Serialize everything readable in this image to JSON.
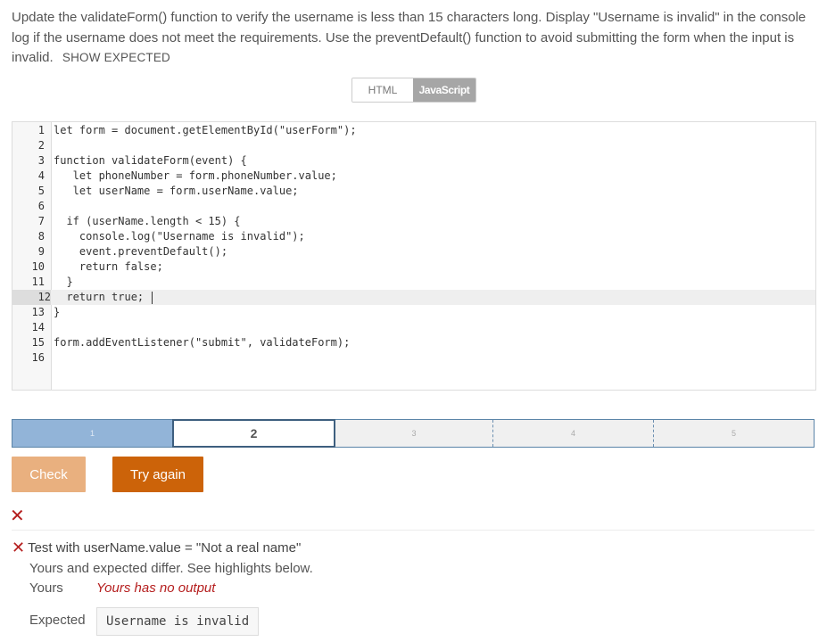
{
  "instructions": {
    "text": "Update the validateForm() function to verify the username is less than 15 characters long. Display \"Username is invalid\" in the console log if the username does not meet the requirements. Use the preventDefault() function to avoid submitting the form when the input is invalid.",
    "show_expected_label": "SHOW EXPECTED"
  },
  "lang_tabs": {
    "html": "HTML",
    "javascript": "JavaScript",
    "selected": "JavaScript"
  },
  "editor": {
    "active_line": 12,
    "lines": [
      {
        "n": "1",
        "text": "let form = document.getElementById(\"userForm\");"
      },
      {
        "n": "2",
        "text": ""
      },
      {
        "n": "3",
        "text": "function validateForm(event) {"
      },
      {
        "n": "4",
        "text": "   let phoneNumber = form.phoneNumber.value;"
      },
      {
        "n": "5",
        "text": "   let userName = form.userName.value;"
      },
      {
        "n": "6",
        "text": ""
      },
      {
        "n": "7",
        "text": "  if (userName.length < 15) {"
      },
      {
        "n": "8",
        "text": "    console.log(\"Username is invalid\");"
      },
      {
        "n": "9",
        "text": "    event.preventDefault();"
      },
      {
        "n": "10",
        "text": "    return false;"
      },
      {
        "n": "11",
        "text": "  }"
      },
      {
        "n": "12",
        "text": "  return true; "
      },
      {
        "n": "13",
        "text": "}"
      },
      {
        "n": "14",
        "text": ""
      },
      {
        "n": "15",
        "text": "form.addEventListener(\"submit\", validateForm);"
      },
      {
        "n": "16",
        "text": ""
      }
    ]
  },
  "progress": {
    "steps": [
      "1",
      "2",
      "3",
      "4",
      "5"
    ],
    "current": 2,
    "completed": [
      1
    ]
  },
  "buttons": {
    "check": "Check",
    "try_again": "Try again"
  },
  "results": {
    "x_symbol": "✕",
    "test_label": "Test with userName.value = \"Not a real name\"",
    "differ_text": "Yours and expected differ. See highlights below.",
    "yours_label": "Yours",
    "yours_value": "Yours has no output",
    "expected_label": "Expected",
    "expected_value": "Username is invalid"
  },
  "colors": {
    "error": "#b51e1e",
    "check_button": "#e9b07f",
    "try_again_button": "#cc6309",
    "progress_done": "#92b4d8",
    "progress_border": "#3e5f7f"
  }
}
